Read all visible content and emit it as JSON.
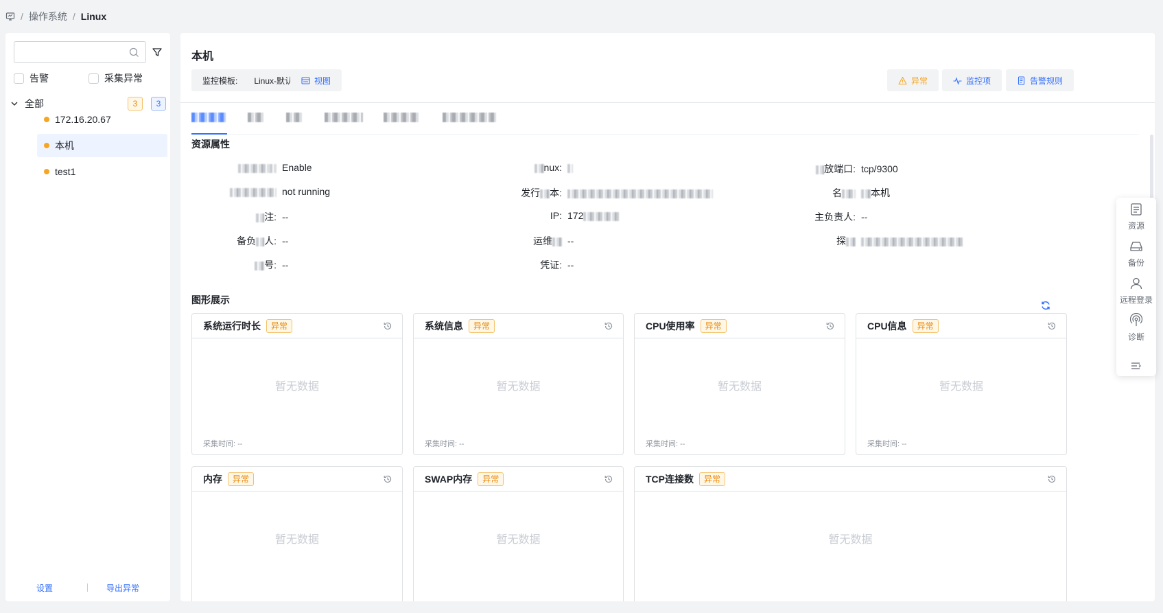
{
  "breadcrumb": {
    "items": [
      "操作系统",
      "Linux"
    ],
    "separator": "/"
  },
  "sidebar": {
    "search_placeholder": "",
    "filters": [
      "告警",
      "采集异常"
    ],
    "tree_root": {
      "label": "全部",
      "badge_warn": "3",
      "badge_info": "3"
    },
    "items": [
      "172.16.20.67",
      "本机",
      "test1"
    ],
    "footer": {
      "settings": "设置",
      "export": "导出异常"
    }
  },
  "main": {
    "title": "本机",
    "template_label": "监控模板:",
    "template_value": "Linux-默认",
    "view_button": "视图",
    "actions": {
      "abnormal": "异常",
      "monitor_items": "监控项",
      "alarm_rules": "告警规则"
    },
    "section_attrs": "资源属性",
    "section_graph": "图形展示",
    "attrs": {
      "r1c1_value": "Enable",
      "r1c2_label_end": "nux:",
      "r1c3_label_end": "放端口:",
      "r1c3_value": "tcp/9300",
      "r2c1_value": "not running",
      "r2c2_label_start": "发行",
      "r2c2_label_end": "本:",
      "r2c3_label_start": "名",
      "r2c3_value_end": "本机",
      "r3c1_label_end": "注:",
      "r3c1_value": "--",
      "r3c2_label_end": "IP:",
      "r3c2_value": "172",
      "r3c3_label": "主负责人:",
      "r3c3_value": "--",
      "r4c1_label_start": "备负",
      "r4c1_label_end": "人:",
      "r4c1_value": "--",
      "r4c2_label_start": "运维",
      "r4c2_value": "--",
      "r4c3_label_start": "探",
      "r5c1_label_end": "号:",
      "r5c1_value": "--",
      "r5c2_label": "凭证:",
      "r5c2_value": "--"
    },
    "cards": [
      {
        "title": "系统运行时长",
        "badge": "异常",
        "empty": "暂无数据",
        "time": "采集时间: --"
      },
      {
        "title": "系统信息",
        "badge": "异常",
        "empty": "暂无数据",
        "time": "采集时间: --"
      },
      {
        "title": "CPU使用率",
        "badge": "异常",
        "empty": "暂无数据",
        "time": "采集时间: --"
      },
      {
        "title": "CPU信息",
        "badge": "异常",
        "empty": "暂无数据",
        "time": "采集时间: --"
      },
      {
        "title": "内存",
        "badge": "异常",
        "empty": "暂无数据"
      },
      {
        "title": "SWAP内存",
        "badge": "异常",
        "empty": "暂无数据"
      },
      {
        "title": "TCP连接数",
        "badge": "异常",
        "empty": "暂无数据"
      }
    ]
  },
  "floatbar": {
    "items": [
      "资源",
      "备份",
      "远程登录",
      "诊断"
    ]
  },
  "colors": {
    "primary": "#3370ff",
    "warning": "#f5a623",
    "badge_bg": "#fff7e6"
  }
}
